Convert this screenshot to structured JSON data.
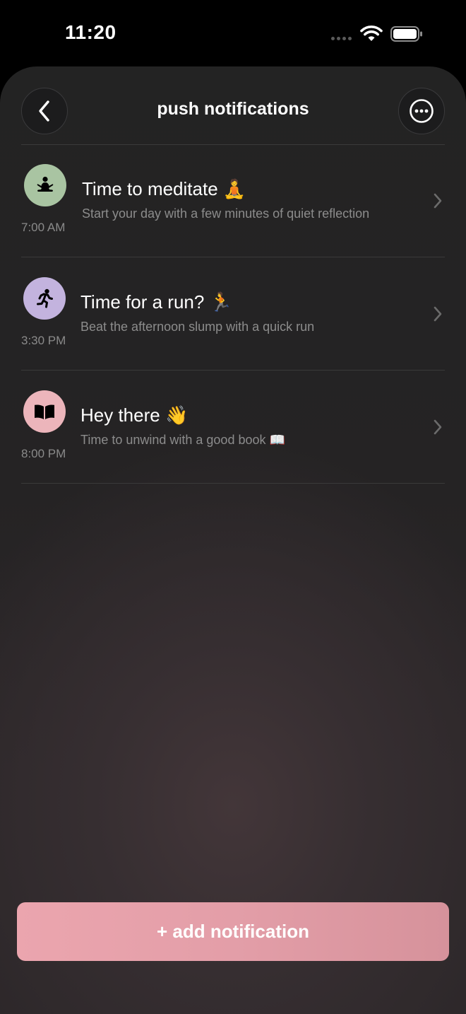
{
  "status_bar": {
    "time": "11:20"
  },
  "header": {
    "title": "push notifications",
    "back_icon": "chevron-left-icon",
    "more_icon": "ellipsis-circle-icon"
  },
  "notifications": [
    {
      "title": "Time to meditate 🧘",
      "subtitle": "Start your day with a few minutes of quiet reflection",
      "time": "7:00 AM",
      "icon": "meditation-icon",
      "icon_bg": "#a9c4a2"
    },
    {
      "title": "Time for a run? 🏃",
      "subtitle": "Beat the afternoon slump with a quick run",
      "time": "3:30 PM",
      "icon": "running-icon",
      "icon_bg": "#c3b3de"
    },
    {
      "title": "Hey there 👋",
      "subtitle": "Time to unwind with a good book 📖",
      "time": "8:00 PM",
      "icon": "book-icon",
      "icon_bg": "#ecb5bb"
    }
  ],
  "add_button": {
    "label": "+ add notification",
    "color": "#e6a2ab"
  }
}
